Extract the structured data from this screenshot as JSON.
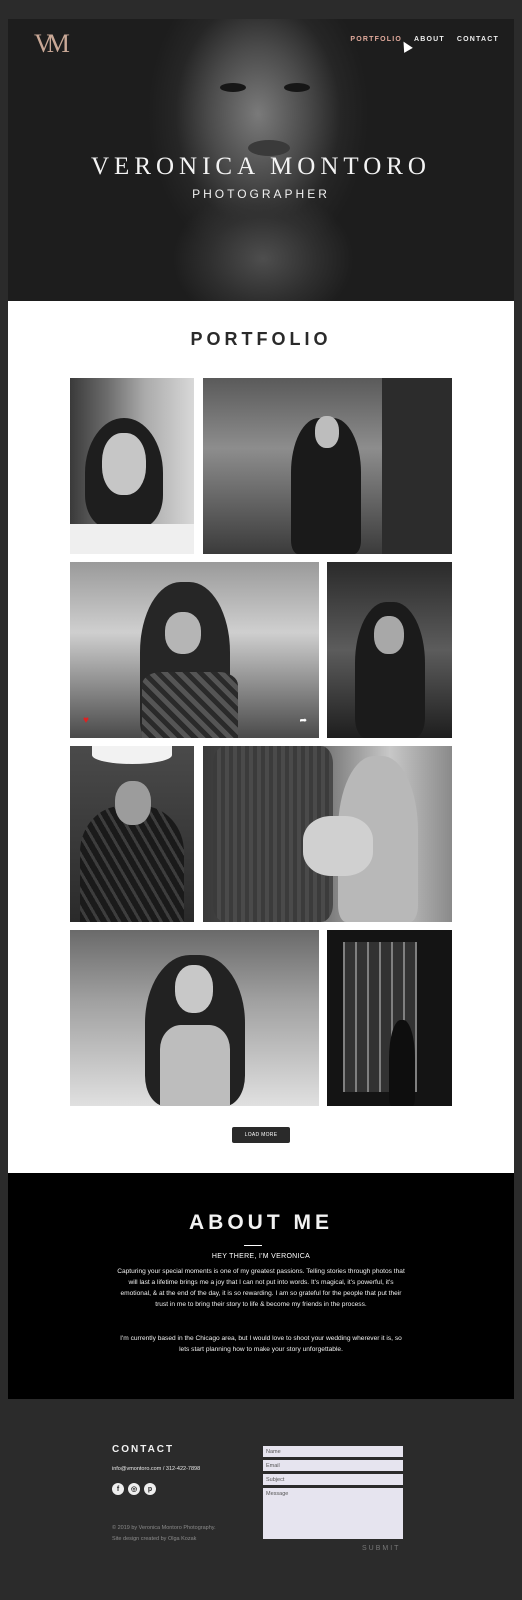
{
  "header": {
    "logo": "VM",
    "nav": [
      "PORTFOLIO",
      "ABOUT",
      "CONTACT"
    ],
    "name": "VERONICA MONTORO",
    "subtitle": "PHOTOGRAPHER"
  },
  "portfolio": {
    "title": "PORTFOLIO",
    "load_more": "LOAD MORE"
  },
  "about": {
    "title": "ABOUT ME",
    "greeting": "HEY THERE, I'M VERONICA",
    "paragraph1": "Capturing your special moments is one of my greatest passions. Telling stories through photos that will last a lifetime brings me a joy that I can not put into words. It's magical, it's powerful, it's emotional, & at the end of the day, it is so rewarding. I am so grateful for the people that put their trust in me to bring their story to life & become my friends in the process.",
    "paragraph2": "I'm currently based in the Chicago area, but I would love to shoot your wedding wherever it is, so lets start planning how to make your story unforgettable."
  },
  "contact": {
    "title": "CONTACT",
    "info": "info@vmontoro.com  /  312-422-7898",
    "copyright_line1": "© 2019 by Veronica Montoro Photography.",
    "copyright_line2": "Site design created by Olga Kozak",
    "placeholders": {
      "name": "Name",
      "email": "Email",
      "subject": "Subject",
      "message": "Message"
    },
    "submit": "SUBMIT"
  },
  "colors": {
    "accent": "#e0a99b",
    "background": "#2b2b2b",
    "about_bg": "#000000",
    "field_bg": "#e6e4ef"
  }
}
